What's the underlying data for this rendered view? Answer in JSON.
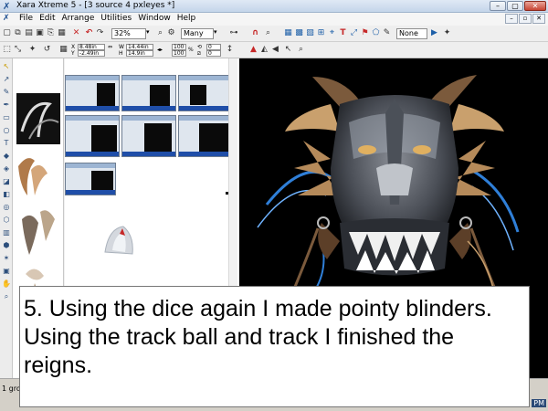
{
  "window": {
    "title": "Xara Xtreme 5 - [3 source 4 pxleyes *]",
    "buttons": {
      "minimize": "–",
      "maximize": "▢",
      "close": "✕"
    }
  },
  "menu": {
    "items": [
      "File",
      "Edit",
      "Arrange",
      "Utilities",
      "Window",
      "Help"
    ],
    "doc_buttons": [
      "–",
      "▫",
      "✕"
    ]
  },
  "toolbar": {
    "zoom": "32%",
    "quality": "Many",
    "none_label": "None"
  },
  "infobar": {
    "x": "8.48in",
    "y": "-2.49in",
    "w": "14.44in",
    "h": "14.9in",
    "scale_w": "100",
    "scale_h": "100",
    "angle": "0",
    "skew": "0"
  },
  "statusbar": {
    "left_text": "1 gro",
    "right_text": "PM"
  },
  "caption": {
    "text": "5. Using the dice again I made pointy blinders. Using the track ball and track I finished the reigns."
  },
  "icons": [
    "xara-logo-icon",
    "document-icon",
    "new-icon",
    "open-icon",
    "save-icon",
    "undo-icon",
    "redo-icon",
    "delete-icon",
    "zoom-icon",
    "selector-icon",
    "pen-icon",
    "text-icon",
    "rectangle-icon",
    "ellipse-icon",
    "fill-icon",
    "transparency-icon",
    "shadow-icon",
    "bevel-icon"
  ]
}
